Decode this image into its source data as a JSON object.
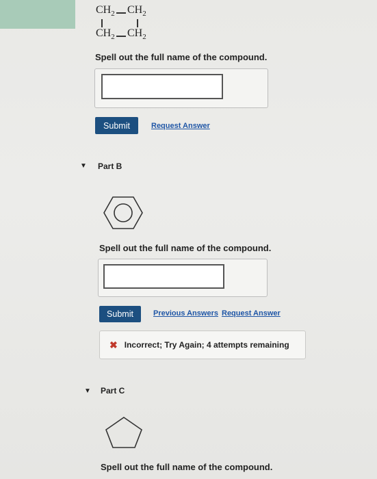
{
  "part_a": {
    "structure": {
      "top_left": "CH",
      "top_right": "CH",
      "bottom_left": "CH",
      "bottom_right": "CH",
      "subscript": "2"
    },
    "question": "Spell out the full name of the compound.",
    "input_value": "",
    "submit_label": "Submit",
    "request_answer_label": "Request Answer"
  },
  "part_b": {
    "label": "Part B",
    "structure_icon": "benzene-ring-icon",
    "question": "Spell out the full name of the compound.",
    "input_value": "",
    "submit_label": "Submit",
    "previous_answers_label": "Previous Answers",
    "request_answer_label": "Request Answer",
    "feedback": {
      "icon": "x-icon",
      "text": "Incorrect; Try Again; 4 attempts remaining"
    }
  },
  "part_c": {
    "label": "Part C",
    "structure_icon": "cyclopentane-ring-icon",
    "question": "Spell out the full name of the compound."
  },
  "colors": {
    "submit_bg": "#1c4f80",
    "link": "#1f56a6",
    "error_x": "#c0392b",
    "accent_green": "#a8cbb8"
  }
}
